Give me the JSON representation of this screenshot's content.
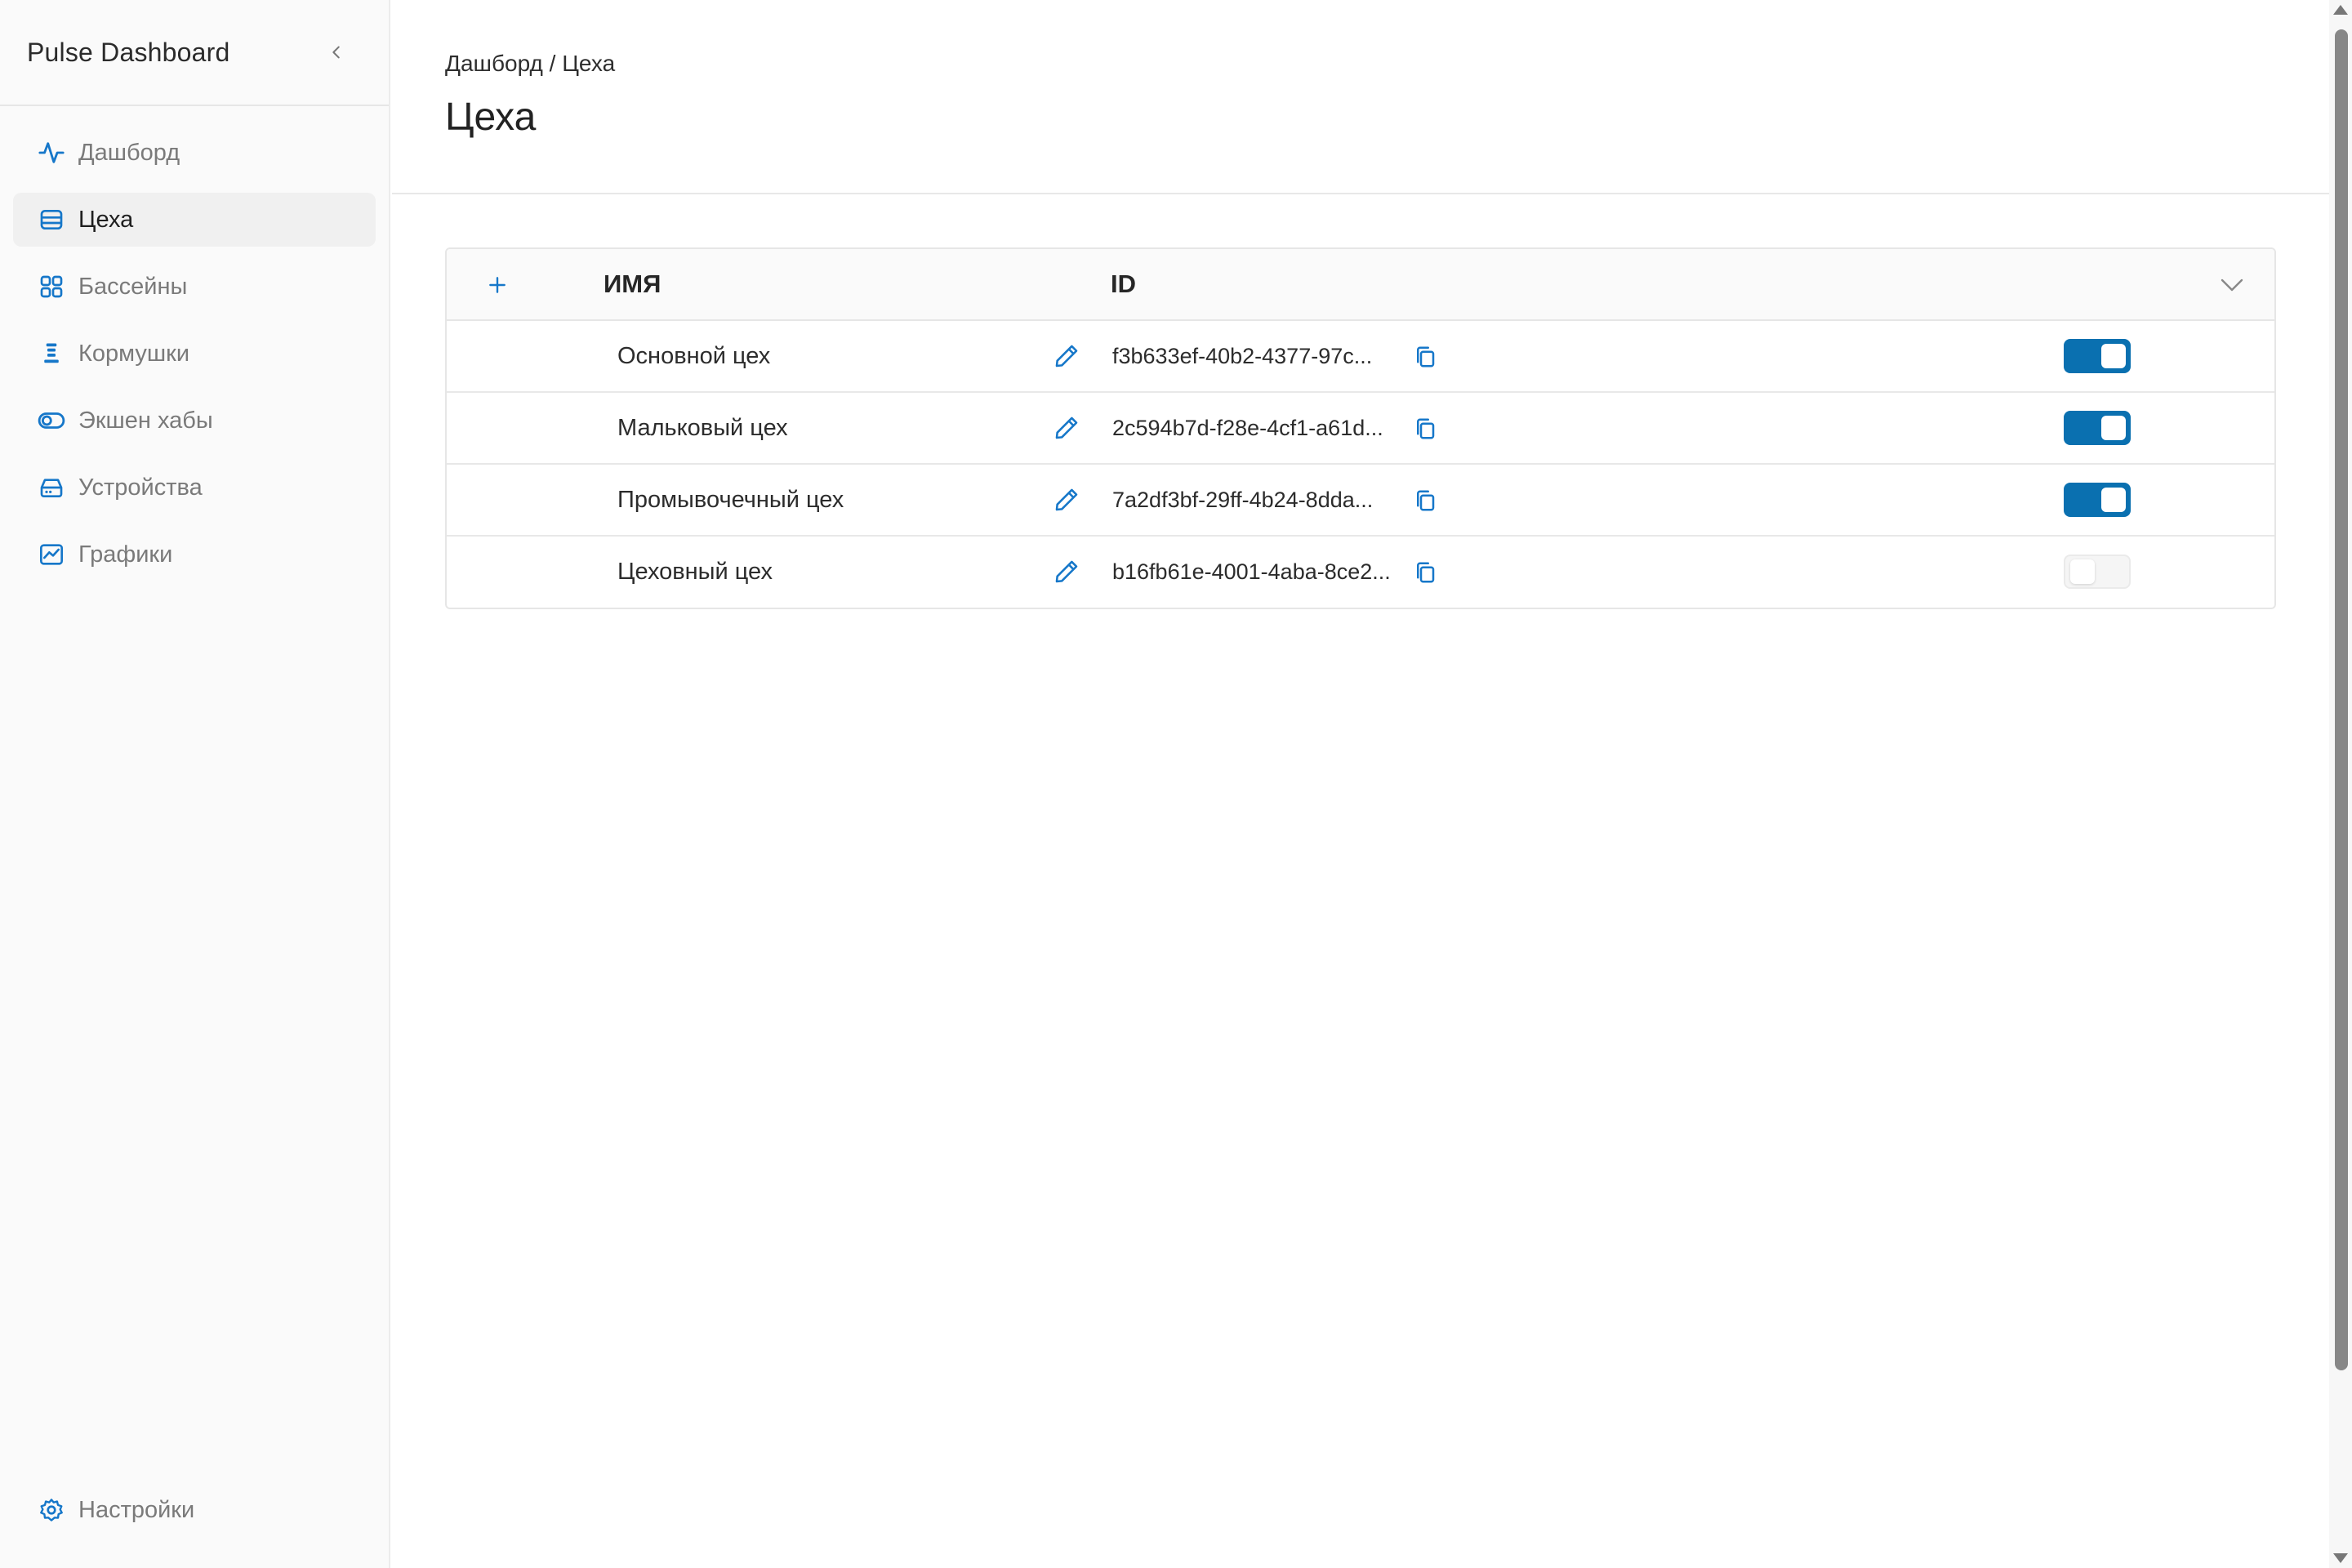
{
  "app": {
    "title": "Pulse Dashboard"
  },
  "sidebar": {
    "items": [
      {
        "label": "Дашборд",
        "icon": "activity-icon"
      },
      {
        "label": "Цеха",
        "icon": "layers-icon",
        "active": true
      },
      {
        "label": "Бассейны",
        "icon": "grid-icon"
      },
      {
        "label": "Кормушки",
        "icon": "feeder-icon"
      },
      {
        "label": "Экшен хабы",
        "icon": "toggle-icon"
      },
      {
        "label": "Устройства",
        "icon": "device-icon"
      },
      {
        "label": "Графики",
        "icon": "chart-icon"
      }
    ],
    "settings_label": "Настройки"
  },
  "header": {
    "breadcrumb": "Дашборд / Цеха",
    "title": "Цеха"
  },
  "table": {
    "columns": {
      "name": "ИМЯ",
      "id": "ID"
    },
    "rows": [
      {
        "name": "Основной цех",
        "id": "f3b633ef-40b2-4377-97c...",
        "enabled": true
      },
      {
        "name": "Мальковый цех",
        "id": "2c594b7d-f28e-4cf1-a61d...",
        "enabled": true
      },
      {
        "name": "Промывочечный цех",
        "id": "7a2df3bf-29ff-4b24-8dda...",
        "enabled": true
      },
      {
        "name": "Цеховный цех",
        "id": "b16fb61e-4001-4aba-8ce2...",
        "enabled": false
      }
    ]
  },
  "colors": {
    "accent": "#0a70b0",
    "icon": "#1677c9"
  }
}
